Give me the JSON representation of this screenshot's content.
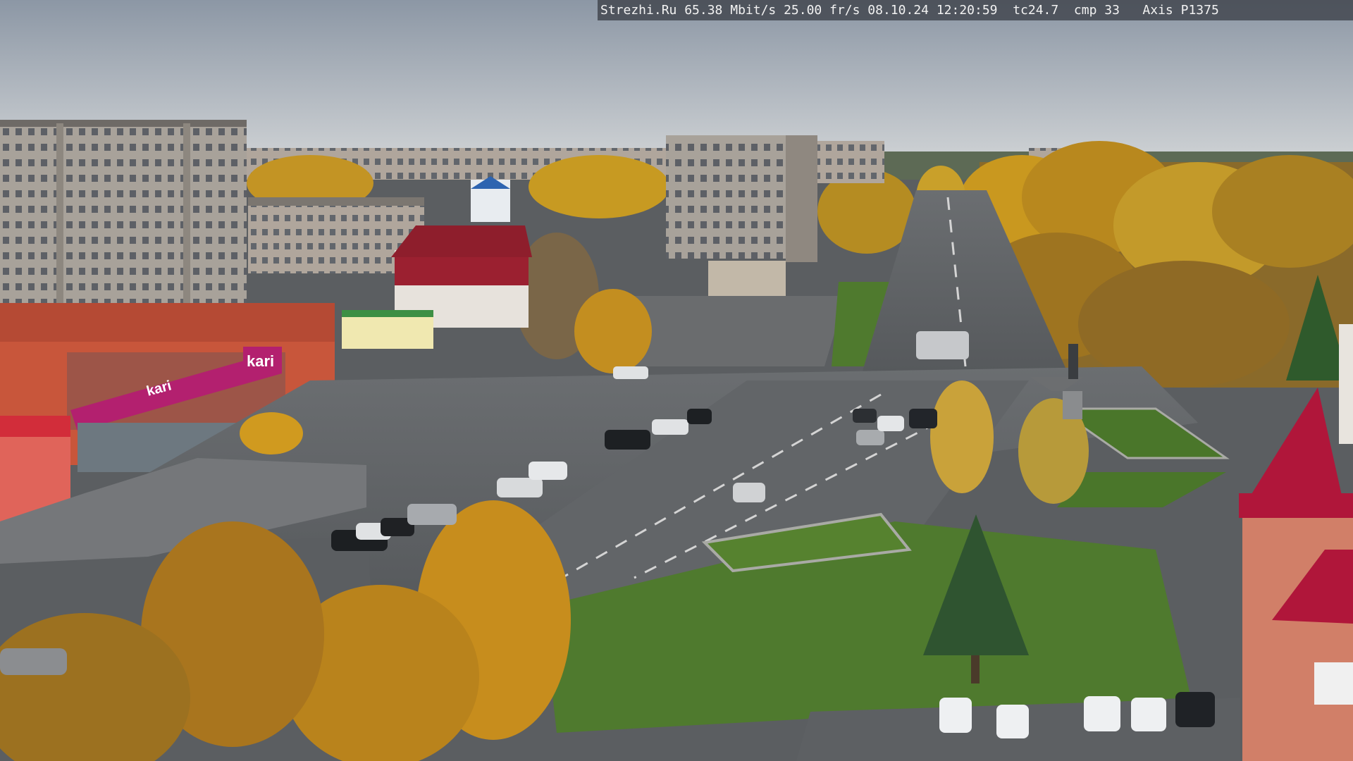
{
  "overlay": {
    "text": "Strezhi.Ru 65.38 Mbit/s 25.00 fr/s 08.10.24 12:20:59  tc24.7  cmp 33   Axis P1375"
  },
  "scene": {
    "store_sign": "kari",
    "store_sign_secondary": "kari",
    "colors": {
      "sky_top": "#8d98a6",
      "sky_bottom": "#cfd3d6",
      "asphalt": "#5a5d60",
      "grass": "#4f7a2e",
      "autumn_foliage": "#c9921f",
      "storefront": "#c8563b",
      "magenta_sign": "#b3206f",
      "roof_red": "#b0163a"
    }
  }
}
